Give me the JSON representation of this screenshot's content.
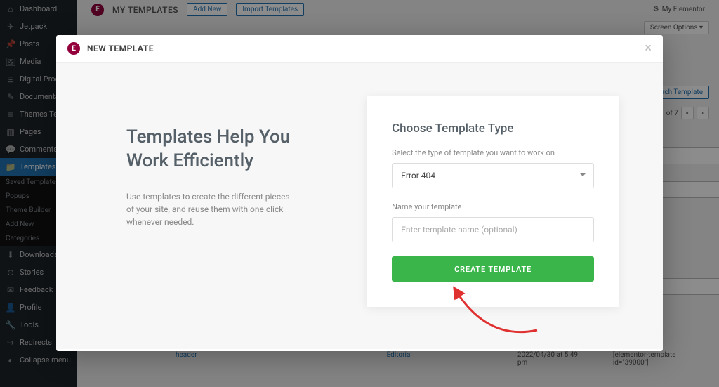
{
  "sidebar": {
    "items": [
      {
        "icon": "⌂",
        "label": "Dashboard"
      },
      {
        "icon": "✈",
        "label": "Jetpack"
      },
      {
        "icon": "📌",
        "label": "Posts"
      },
      {
        "icon": "🖼",
        "label": "Media"
      },
      {
        "icon": "⊟",
        "label": "Digital Produ…"
      },
      {
        "icon": "✎",
        "label": "Documentati…"
      },
      {
        "icon": "≡",
        "label": "Themes Tem…"
      },
      {
        "icon": "▥",
        "label": "Pages"
      },
      {
        "icon": "💬",
        "label": "Comments",
        "badge": true
      },
      {
        "icon": "📁",
        "label": "Templates",
        "active": true
      }
    ],
    "sub": [
      "Saved Templates",
      "Popups",
      "Theme Builder",
      "Add New",
      "Categories"
    ],
    "items2": [
      {
        "icon": "⬇",
        "label": "Downloads"
      },
      {
        "icon": "⊙",
        "label": "Stories"
      },
      {
        "icon": "✉",
        "label": "Feedback"
      },
      {
        "icon": "👤",
        "label": "Profile"
      },
      {
        "icon": "🔧",
        "label": "Tools"
      },
      {
        "icon": "↪",
        "label": "Redirects"
      },
      {
        "icon": "◐",
        "label": "Collapse menu"
      }
    ]
  },
  "page": {
    "title": "MY TEMPLATES",
    "add_new": "Add New",
    "import": "Import Templates",
    "my_elementor": "My Elementor",
    "screen_options": "Screen Options ▾",
    "search": "Search Template",
    "pager_text": "of 7",
    "row_title": "header",
    "row_author": "Editorial",
    "row_date": "2022/04/30 at 5:49 pm",
    "row_shortcode": "[elementor-template id=\"39000\"]"
  },
  "modal": {
    "header": "NEW TEMPLATE",
    "left_heading": "Templates Help You Work Efficiently",
    "left_body": "Use templates to create the different pieces of your site, and reuse them with one click whenever needed.",
    "form": {
      "heading": "Choose Template Type",
      "type_label": "Select the type of template you want to work on",
      "type_value": "Error 404",
      "name_label": "Name your template",
      "name_placeholder": "Enter template name (optional)",
      "submit": "CREATE TEMPLATE"
    }
  }
}
